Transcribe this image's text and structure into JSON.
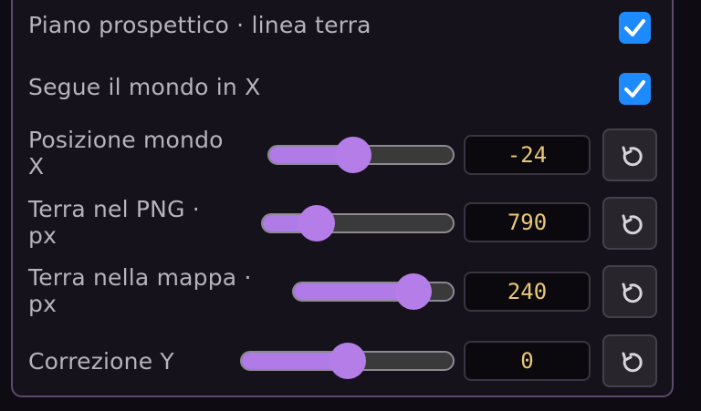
{
  "settings": [
    {
      "id": "piano",
      "label": "Piano prospettico · linea terra",
      "type": "checkbox",
      "checked": true
    },
    {
      "id": "segue",
      "label": "Segue il mondo in X",
      "type": "checkbox",
      "checked": true
    },
    {
      "id": "posx",
      "label_line1": "Posizione mondo",
      "label_line2": "X",
      "type": "slider",
      "value": "-24",
      "level": 0.45
    },
    {
      "id": "terrapng",
      "label_line1": "Terra nel PNG ·",
      "label_line2": "px",
      "type": "slider",
      "value": "790",
      "level": 0.24
    },
    {
      "id": "terramappa",
      "label_line1": "Terra nella mappa ·",
      "label_line2": "px",
      "type": "slider",
      "value": "240",
      "level": 0.82
    },
    {
      "id": "corry",
      "label": "Correzione Y",
      "type": "slider",
      "value": "0",
      "level": 0.5
    }
  ],
  "icons": {
    "reset": "reset-icon",
    "check": "check-icon"
  },
  "colors": {
    "accent": "#b07be6",
    "checkbox": "#1d8bff",
    "value_text": "#e8c77a"
  }
}
